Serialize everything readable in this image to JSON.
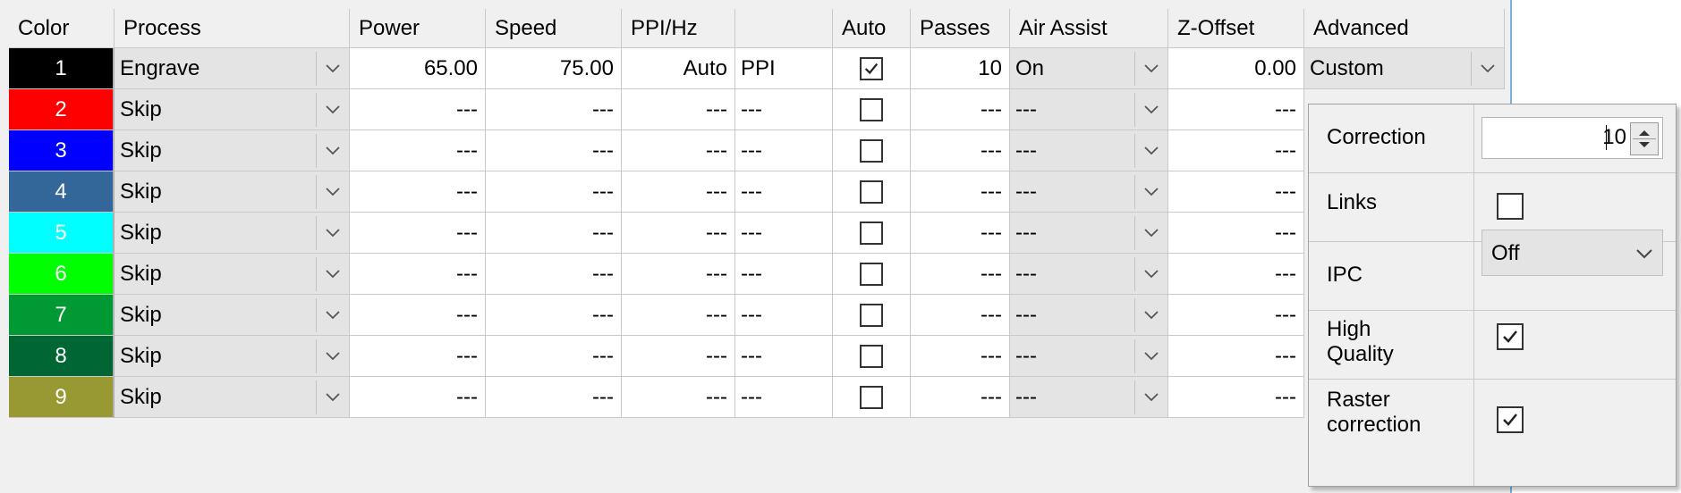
{
  "colors": {
    "row1": "#000000",
    "row2": "#ff0000",
    "row3": "#0000ff",
    "row4": "#336699",
    "row5": "#00ffff",
    "row6": "#00ff00",
    "row7": "#009933",
    "row8": "#006633",
    "row9": "#999933"
  },
  "headers": {
    "color": "Color",
    "process": "Process",
    "power": "Power",
    "speed": "Speed",
    "ppi": "PPI/Hz",
    "blank": "",
    "auto": "Auto",
    "passes": "Passes",
    "air": "Air Assist",
    "zoffset": "Z-Offset",
    "advanced": "Advanced"
  },
  "rows": [
    {
      "num": "1",
      "process": "Engrave",
      "power": "65.00",
      "speed": "75.00",
      "ppi": "Auto",
      "unit": "PPI",
      "auto": true,
      "passes": "10",
      "air": "On",
      "zoffset": "0.00",
      "advanced": "Custom"
    },
    {
      "num": "2",
      "process": "Skip",
      "power": "---",
      "speed": "---",
      "ppi": "---",
      "unit": "---",
      "auto": false,
      "passes": "---",
      "air": "---",
      "zoffset": "---"
    },
    {
      "num": "3",
      "process": "Skip",
      "power": "---",
      "speed": "---",
      "ppi": "---",
      "unit": "---",
      "auto": false,
      "passes": "---",
      "air": "---",
      "zoffset": "---"
    },
    {
      "num": "4",
      "process": "Skip",
      "power": "---",
      "speed": "---",
      "ppi": "---",
      "unit": "---",
      "auto": false,
      "passes": "---",
      "air": "---",
      "zoffset": "---"
    },
    {
      "num": "5",
      "process": "Skip",
      "power": "---",
      "speed": "---",
      "ppi": "---",
      "unit": "---",
      "auto": false,
      "passes": "---",
      "air": "---",
      "zoffset": "---"
    },
    {
      "num": "6",
      "process": "Skip",
      "power": "---",
      "speed": "---",
      "ppi": "---",
      "unit": "---",
      "auto": false,
      "passes": "---",
      "air": "---",
      "zoffset": "---"
    },
    {
      "num": "7",
      "process": "Skip",
      "power": "---",
      "speed": "---",
      "ppi": "---",
      "unit": "---",
      "auto": false,
      "passes": "---",
      "air": "---",
      "zoffset": "---"
    },
    {
      "num": "8",
      "process": "Skip",
      "power": "---",
      "speed": "---",
      "ppi": "---",
      "unit": "---",
      "auto": false,
      "passes": "---",
      "air": "---",
      "zoffset": "---"
    },
    {
      "num": "9",
      "process": "Skip",
      "power": "---",
      "speed": "---",
      "ppi": "---",
      "unit": "---",
      "auto": false,
      "passes": "---",
      "air": "---",
      "zoffset": "---"
    }
  ],
  "advanced_popup": {
    "correction_label": "Correction",
    "correction_value": "10",
    "links_label": "Links",
    "links_checked": false,
    "ipc_label": "IPC",
    "ipc_value": "Off",
    "hq_label_1": "High",
    "hq_label_2": "Quality",
    "hq_checked": true,
    "raster_label_1": "Raster",
    "raster_label_2": "correction",
    "raster_checked": true
  },
  "icons": {
    "dropdown": "chevron-down-icon",
    "check": "checkmark-icon",
    "spin": "spin-up-down-icon"
  }
}
